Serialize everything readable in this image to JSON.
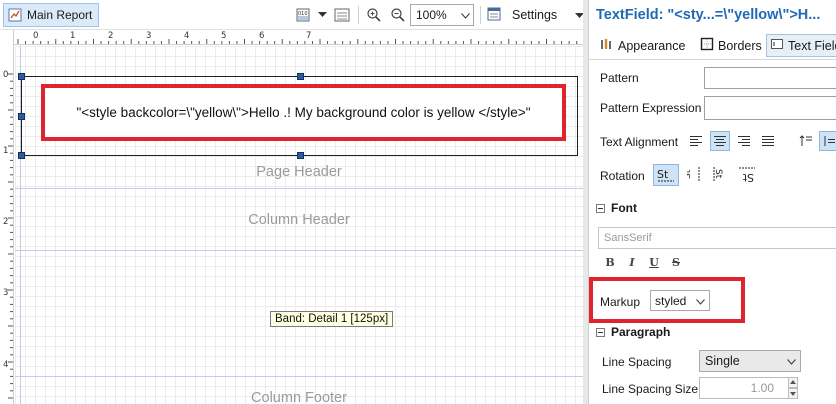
{
  "designer": {
    "tab_label": "Main Report",
    "zoom_value": "100%",
    "settings_label": "Settings",
    "textfield_content": "\"<style backcolor=\\\"yellow\\\">Hello .! My background color is yellow </style>\"",
    "bands": {
      "page_header": "Page Header",
      "column_header": "Column Header",
      "column_footer": "Column Footer"
    },
    "tooltip": "Band: Detail 1 [125px]",
    "ruler_top": [
      "0",
      "1",
      "2",
      "3",
      "4",
      "5",
      "6",
      "7"
    ],
    "ruler_left": [
      "0",
      "1",
      "2",
      "3",
      "4"
    ]
  },
  "props": {
    "title": "TextField: \"<sty...=\\\"yellow\\\">H...",
    "tabs": [
      "Appearance",
      "Borders",
      "Text Field"
    ],
    "pattern_label": "Pattern",
    "pattern_expression_label": "Pattern Expression",
    "text_alignment_label": "Text Alignment",
    "rotation_label": "Rotation",
    "font_section": "Font",
    "font_name_placeholder": "SansSerif",
    "format_buttons": [
      "B",
      "I",
      "U",
      "S"
    ],
    "markup_label": "Markup",
    "markup_value": "styled",
    "paragraph_section": "Paragraph",
    "line_spacing_label": "Line Spacing",
    "line_spacing_value": "Single",
    "line_spacing_size_label": "Line Spacing Size",
    "line_spacing_size_value": "1.00"
  },
  "colors": {
    "highlight_red": "#e0242b",
    "title_blue": "#1f6ab5",
    "handle_blue": "#2f5b9a"
  }
}
